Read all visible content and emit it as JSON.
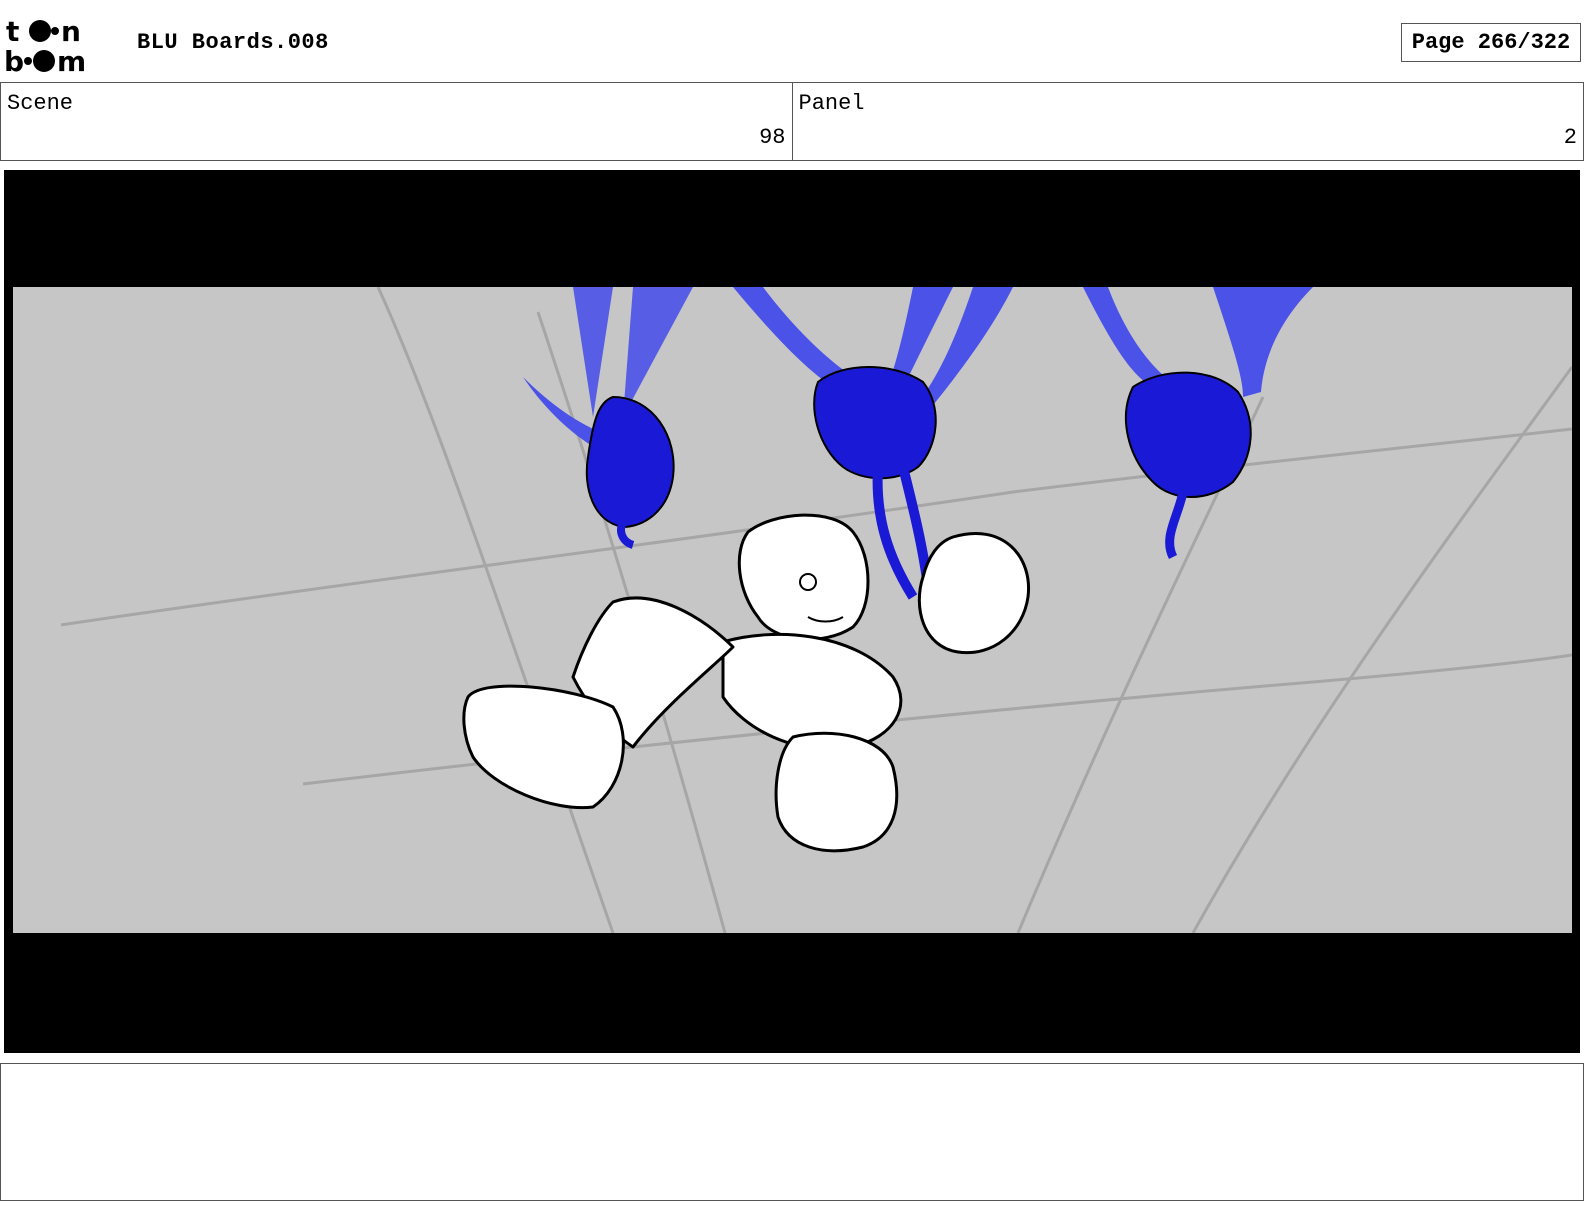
{
  "header": {
    "logo_text": "toon boom",
    "title": "BLU Boards.008",
    "page_label": "Page 266/322"
  },
  "info": {
    "scene_label": "Scene",
    "scene_value": "98",
    "panel_label": "Panel",
    "panel_value": "2"
  },
  "colors": {
    "letterbox": "#000000",
    "background": "#c6c6c6",
    "creature_blue": "#1a1ad6",
    "wing_blue": "#4a52e8"
  },
  "notes": {
    "text": ""
  }
}
